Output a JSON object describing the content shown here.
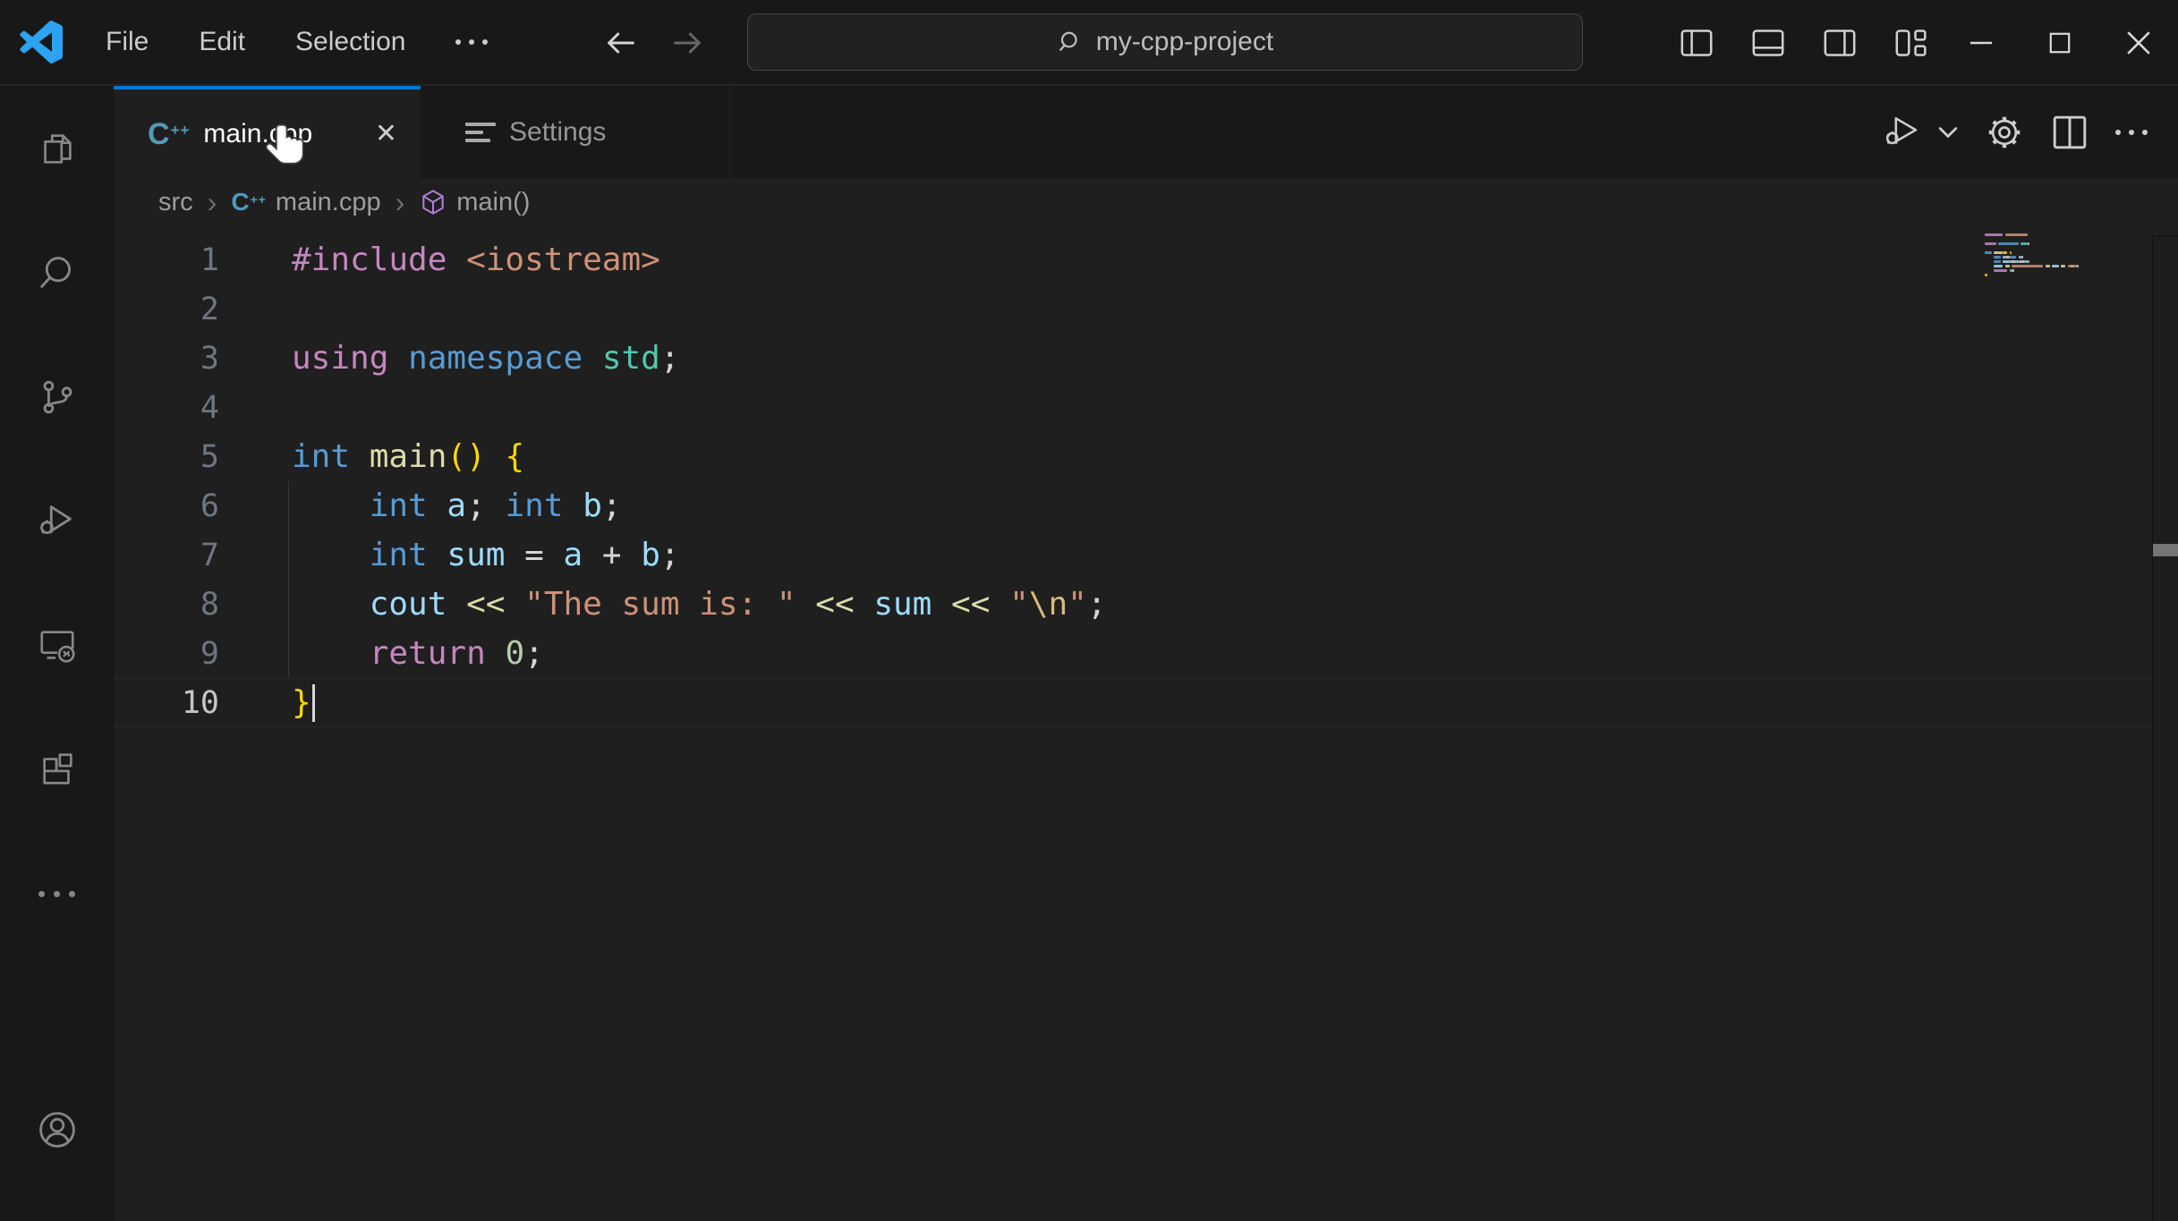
{
  "titlebar": {
    "menus": [
      {
        "label": "File"
      },
      {
        "label": "Edit"
      },
      {
        "label": "Selection"
      }
    ],
    "search_value": "my-cpp-project"
  },
  "tabs": [
    {
      "label": "main.cpp",
      "active": true
    },
    {
      "label": "Settings",
      "active": false
    }
  ],
  "breadcrumbs": [
    {
      "label": "src"
    },
    {
      "label": "main.cpp"
    },
    {
      "label": "main()"
    }
  ],
  "icons": {
    "close_tab": "✕",
    "breadcrumb_separator": "›"
  },
  "colors": {
    "accent": "#0078d4",
    "cpp_icon": "#519aba",
    "symbol_method": "#b180d7",
    "keyword": "#C586C0",
    "type": "#569CD6",
    "class": "#4EC9B0",
    "func": "#DCDCAA",
    "var": "#9CDCFE",
    "string": "#CE9178",
    "escape": "#D7BA7D",
    "num": "#B5CEA8",
    "plain": "#D4D4D4",
    "bracket": "#FFD700"
  },
  "code": {
    "lines": [
      {
        "n": 1,
        "tokens": [
          {
            "t": "#include",
            "c": "keyword"
          },
          {
            "t": " ",
            "c": "plain"
          },
          {
            "t": "<iostream>",
            "c": "string"
          }
        ]
      },
      {
        "n": 2,
        "tokens": []
      },
      {
        "n": 3,
        "tokens": [
          {
            "t": "using",
            "c": "keyword"
          },
          {
            "t": " ",
            "c": "plain"
          },
          {
            "t": "namespace",
            "c": "type"
          },
          {
            "t": " ",
            "c": "plain"
          },
          {
            "t": "std",
            "c": "class"
          },
          {
            "t": ";",
            "c": "plain"
          }
        ]
      },
      {
        "n": 4,
        "tokens": []
      },
      {
        "n": 5,
        "tokens": [
          {
            "t": "int",
            "c": "type"
          },
          {
            "t": " ",
            "c": "plain"
          },
          {
            "t": "main",
            "c": "func"
          },
          {
            "t": "()",
            "c": "bracket"
          },
          {
            "t": " ",
            "c": "plain"
          },
          {
            "t": "{",
            "c": "bracket"
          }
        ]
      },
      {
        "n": 6,
        "guide": true,
        "tokens": [
          {
            "t": "    ",
            "c": "plain"
          },
          {
            "t": "int",
            "c": "type"
          },
          {
            "t": " ",
            "c": "plain"
          },
          {
            "t": "a",
            "c": "var"
          },
          {
            "t": "; ",
            "c": "plain"
          },
          {
            "t": "int",
            "c": "type"
          },
          {
            "t": " ",
            "c": "plain"
          },
          {
            "t": "b",
            "c": "var"
          },
          {
            "t": ";",
            "c": "plain"
          }
        ]
      },
      {
        "n": 7,
        "guide": true,
        "tokens": [
          {
            "t": "    ",
            "c": "plain"
          },
          {
            "t": "int",
            "c": "type"
          },
          {
            "t": " ",
            "c": "plain"
          },
          {
            "t": "sum",
            "c": "var"
          },
          {
            "t": " = ",
            "c": "plain"
          },
          {
            "t": "a",
            "c": "var"
          },
          {
            "t": " + ",
            "c": "plain"
          },
          {
            "t": "b",
            "c": "var"
          },
          {
            "t": ";",
            "c": "plain"
          }
        ]
      },
      {
        "n": 8,
        "guide": true,
        "tokens": [
          {
            "t": "    ",
            "c": "plain"
          },
          {
            "t": "cout",
            "c": "var"
          },
          {
            "t": " ",
            "c": "plain"
          },
          {
            "t": "<<",
            "c": "func"
          },
          {
            "t": " ",
            "c": "plain"
          },
          {
            "t": "\"The sum is: \"",
            "c": "string"
          },
          {
            "t": " ",
            "c": "plain"
          },
          {
            "t": "<<",
            "c": "func"
          },
          {
            "t": " ",
            "c": "plain"
          },
          {
            "t": "sum",
            "c": "var"
          },
          {
            "t": " ",
            "c": "plain"
          },
          {
            "t": "<<",
            "c": "func"
          },
          {
            "t": " ",
            "c": "plain"
          },
          {
            "t": "\"",
            "c": "string"
          },
          {
            "t": "\\n",
            "c": "escape"
          },
          {
            "t": "\"",
            "c": "string"
          },
          {
            "t": ";",
            "c": "plain"
          }
        ]
      },
      {
        "n": 9,
        "guide": true,
        "tokens": [
          {
            "t": "    ",
            "c": "plain"
          },
          {
            "t": "return",
            "c": "keyword"
          },
          {
            "t": " ",
            "c": "plain"
          },
          {
            "t": "0",
            "c": "num"
          },
          {
            "t": ";",
            "c": "plain"
          }
        ]
      },
      {
        "n": 10,
        "active": true,
        "cursor": true,
        "tokens": [
          {
            "t": "}",
            "c": "bracket"
          }
        ]
      }
    ]
  }
}
